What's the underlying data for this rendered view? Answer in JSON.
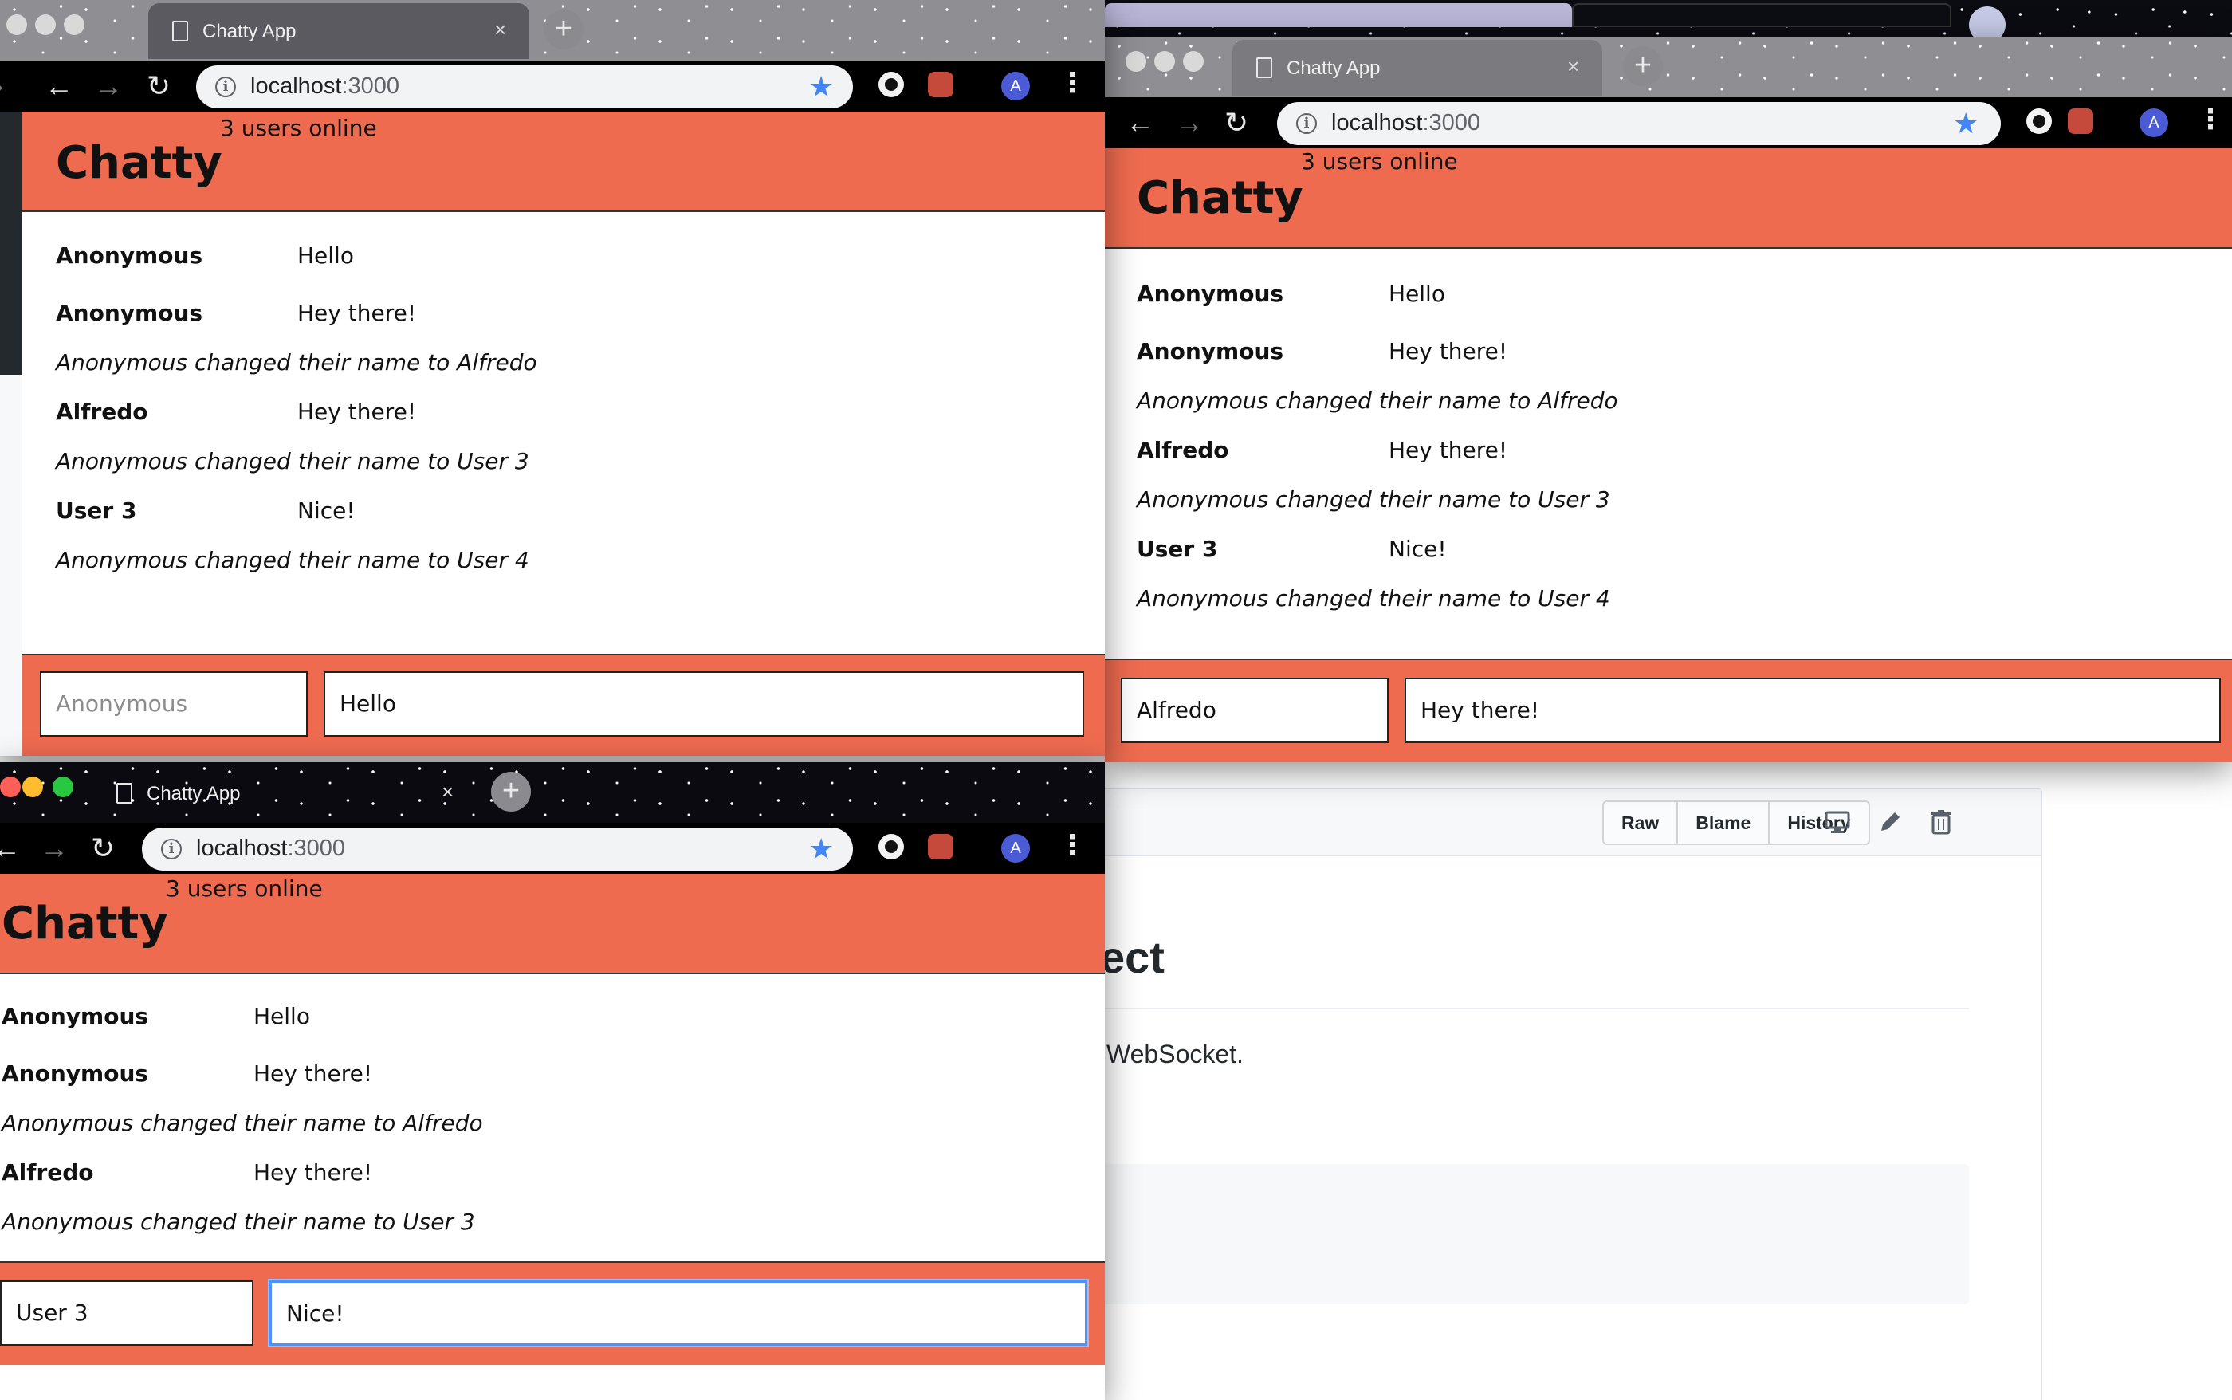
{
  "browser": {
    "tab_title": "Chatty App",
    "close_glyph": "×",
    "newtab_glyph": "+",
    "url_host": "localhost",
    "url_port": ":3000",
    "avatar_letter": "A"
  },
  "chatty": {
    "title": "Chatty",
    "users_online": "3 users online",
    "messages": [
      {
        "kind": "message",
        "username": "Anonymous",
        "content": "Hello"
      },
      {
        "kind": "message",
        "username": "Anonymous",
        "content": "Hey there!"
      },
      {
        "kind": "notification",
        "content": "Anonymous changed their name to Alfredo"
      },
      {
        "kind": "message",
        "username": "Alfredo",
        "content": "Hey there!"
      },
      {
        "kind": "notification",
        "content": "Anonymous changed their name to User 3"
      },
      {
        "kind": "message",
        "username": "User 3",
        "content": "Nice!"
      },
      {
        "kind": "notification",
        "content": "Anonymous changed their name to User 4"
      }
    ]
  },
  "windows": [
    {
      "id": "window-1",
      "username_field": {
        "value": "",
        "placeholder": "Anonymous"
      },
      "message_field": {
        "value": "Hello"
      }
    },
    {
      "id": "window-2",
      "username_field": {
        "value": "Alfredo"
      },
      "message_field": {
        "value": "Hey there!"
      }
    },
    {
      "id": "window-3",
      "username_field": {
        "value": "User 3"
      },
      "message_field": {
        "value": "Nice!",
        "focused": true
      }
    }
  ],
  "github": {
    "buttons": [
      "Raw",
      "Blame",
      "History"
    ],
    "heading_fragment": "ect",
    "paragraph_fragment": "WebSocket.",
    "icons": [
      "desktop-icon",
      "pencil-icon",
      "trash-icon"
    ]
  },
  "colors": {
    "chatty_accent": "#ef6b50",
    "focus_ring": "#4d90fe",
    "star": "#4285f4"
  }
}
